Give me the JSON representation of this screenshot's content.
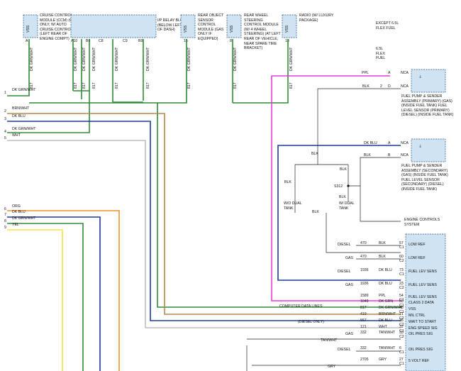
{
  "colors": {
    "dk_grn_wht": "#2e8b36",
    "brn_wht": "#b5894b",
    "dk_blu": "#1c3a9e",
    "wht": "#bdbdbd",
    "org": "#f0902a",
    "yel": "#f5e33c",
    "ppl": "#e83ad8",
    "blk": "#222222",
    "box_fill": "#cfe3f2"
  },
  "modules": {
    "cruise": "CRUISE CONTROL MODULE (CCM) (GAS ONLY, W/ AUTO CRUISE CONTROL) (LEFT REAR OF ENGINE COMPT)",
    "ip_relay": "I/P RELAY BLOCK (BELOW LEFT SIDE OF DASH)",
    "ros": "REAR OBJECT SENSOR CONTROL MODULE (GAS ONLY IF EQUIPPED)",
    "rws": "REAR WHEEL STEERING CONTROL MODULE (W/ 4 WHEEL STEERING) (AT LEFT REAR OF VEHICLE, NEAR SPARE TIRE BRACKET)",
    "radio": "RADIO (W/ LUXURY PACKAGE)",
    "fp_primary": "FUEL PUMP & SENDER ASSEMBLY (PRIMARY) (GAS) (INSIDE FUEL TANK) FUEL LEVEL SENSOR (PRIMARY) (DIESEL) (INSIDE FUEL TANK)",
    "fp_secondary": "FUEL PUMP & SENDER ASSEMBLY (SECONDARY) (GAS) (INSIDE FUEL TANK) FUEL LEVEL SENSOR (SECONDARY) (DIESEL) (INSIDE FUEL TANK)",
    "engine_controls": "ENGINE CONTROLS SYSTEM",
    "computer_data_lines": "COMPUTER DATA LINES"
  },
  "left_wires": [
    {
      "num": "1",
      "label": "DK GRN/WHT"
    },
    {
      "num": "2",
      "label": "BRN/WHT"
    },
    {
      "num": "3",
      "label": "DK BLU"
    },
    {
      "num": "4",
      "label": "DK GRN/WHT"
    },
    {
      "num": "5",
      "label": "WHT"
    },
    {
      "num": "6",
      "label": "ORG"
    },
    {
      "num": "7",
      "label": "DK BLU"
    },
    {
      "num": "8",
      "label": "DK GRN/WHT"
    },
    {
      "num": "9",
      "label": "YEL"
    }
  ],
  "top_wires": {
    "cruise": {
      "color": "DK GRN/WHT",
      "circuit": "817",
      "pin": "A",
      "label": "VSS"
    },
    "relay": [
      {
        "pin": "A10",
        "color": "DK GRN/WHT"
      },
      {
        "pin": "B8",
        "color": "DK GRN/WHT"
      },
      {
        "pin": "C8",
        "color": "DK GRN/WHT"
      },
      {
        "pin": "C9",
        "color": "DK GRN/WHT"
      },
      {
        "pin": "B9",
        "color": "DK GRN/WHT"
      }
    ],
    "relay_circuits": [
      "817",
      "817",
      "817",
      "817",
      "817"
    ],
    "ros": {
      "color": "DK GRN/WHT",
      "circuit": "817",
      "pin": "15",
      "label": "VSS"
    },
    "rws": {
      "color": "DK GRN/WHT",
      "circuit": "817",
      "pin": "8",
      "label": "VSS"
    },
    "radio": {
      "color": "DK GRN/WHT",
      "circuit": "817",
      "pin": "13",
      "label": "VSS"
    }
  },
  "fuel_notes": {
    "except": "EXCEPT 6.5L FLEX FUEL",
    "flex": "6.5L FLEX FUEL",
    "ppl": "PPL",
    "blk": "BLK",
    "blk2": "BLK",
    "pin_a": "A",
    "pin_b": "B",
    "pin_2": "2",
    "pin_d": "D",
    "dk_blu": "DK BLU",
    "nca": "NCA",
    "nca2": "NCA",
    "nca3": "NCA",
    "nca4": "NCA"
  },
  "splice": {
    "label": "S312",
    "blk_labels": [
      "BLK",
      "BLK",
      "BLK",
      "BLK",
      "BLK"
    ],
    "wo_dual": "W/O DUAL TANK",
    "w_dual": "W/ DUAL TANK"
  },
  "pcm_rows": [
    {
      "variant": "DIESEL",
      "circuit": "470",
      "color": "BLK",
      "pin": "57",
      "func": "LOW REF"
    },
    {
      "variant": "GAS",
      "circuit": "470",
      "color": "BLK",
      "pin": "60",
      "func": "LOW REF"
    },
    {
      "variant": "DIESEL",
      "circuit": "1936",
      "color": "DK BLU",
      "pin": "73",
      "func": "FUEL LEV SENS"
    },
    {
      "variant": "GAS",
      "circuit": "1936",
      "color": "DK BLU",
      "pin": "23",
      "func": "FUEL LEV SENS"
    },
    {
      "variant": "",
      "circuit": "1589",
      "color": "PPL",
      "pin": "54",
      "func": "FUEL LEV SENS"
    },
    {
      "variant": "",
      "circuit": "1049",
      "color": "DK GRN",
      "pin": "58",
      "func": "CLASS 2 DATA"
    },
    {
      "variant": "",
      "circuit": "817",
      "color": "DK GRN/WHT",
      "pin": "48",
      "func": "VSS"
    },
    {
      "variant": "",
      "circuit": "419",
      "color": "BRN/WHT",
      "pin": "21",
      "func": "MIL CTRL"
    },
    {
      "variant": "(DIESEL ONLY)",
      "circuit": "557",
      "color": "DK BLU",
      "pin": "36",
      "func": "WAIT TO START"
    },
    {
      "variant": "",
      "circuit": "121",
      "color": "WHT",
      "pin": "32",
      "func": "ENG SPEED SIG"
    },
    {
      "variant": "GAS",
      "circuit": "332",
      "color": "TAN/WHT",
      "pin": "33",
      "func": "OIL PRES SIG"
    },
    {
      "variant": "DIESEL",
      "circuit": "332",
      "color": "TAN/WHT",
      "pin": "6",
      "func": "OIL PRES SIG"
    },
    {
      "variant": "",
      "circuit": "2705",
      "color": "GRY",
      "pin": "27",
      "func": "5 VOLT REF"
    }
  ],
  "pcm_letters": [
    "C1",
    "C2",
    "C1",
    "C2",
    "C1",
    "C1",
    "C1",
    "C2",
    "C2",
    "C1",
    "C2",
    "C1",
    "C1"
  ],
  "bottom_notes": {
    "tan_wht": "TAN/WHT",
    "gry": "GRY",
    "gas": "GAS",
    "diesel": "DIESEL"
  }
}
